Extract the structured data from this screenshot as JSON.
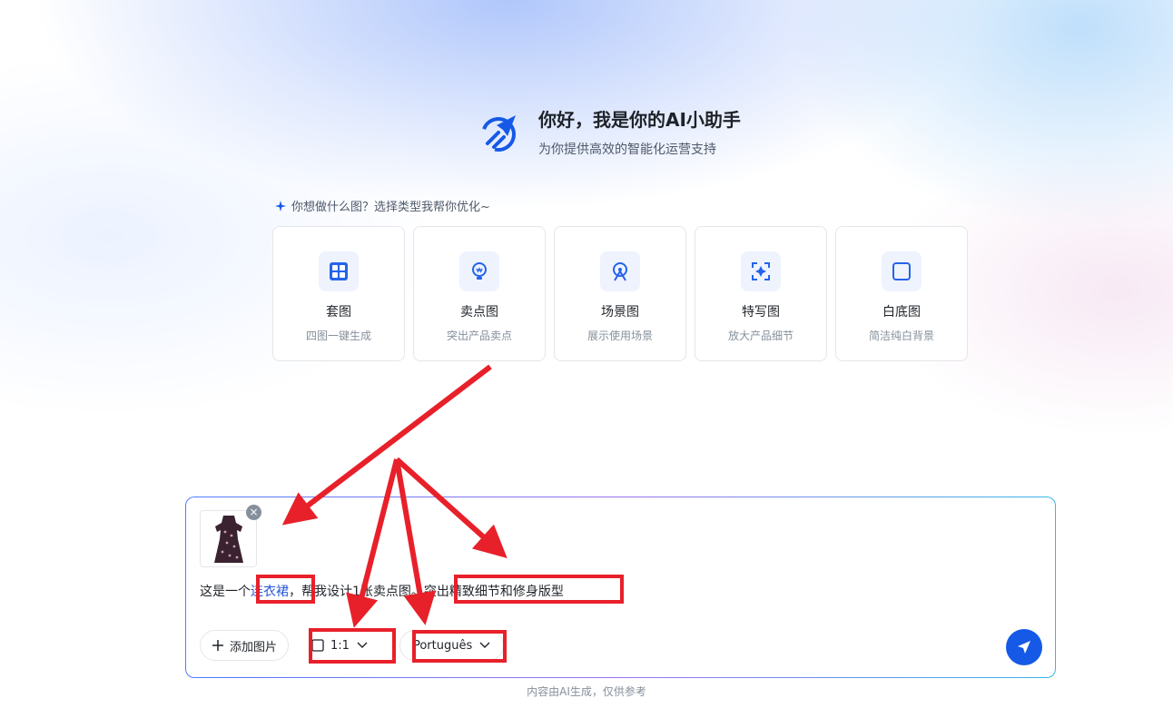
{
  "hero": {
    "title": "你好，我是你的AI小助手",
    "subtitle": "为你提供高效的智能化运营支持"
  },
  "hint": "你想做什么图？选择类型我帮你优化~",
  "cards": [
    {
      "title": "套图",
      "desc": "四图一键生成",
      "icon": "grid-icon"
    },
    {
      "title": "卖点图",
      "desc": "突出产品卖点",
      "icon": "lightbulb-icon"
    },
    {
      "title": "场景图",
      "desc": "展示使用场景",
      "icon": "scene-icon"
    },
    {
      "title": "特写图",
      "desc": "放大产品细节",
      "icon": "focus-icon"
    },
    {
      "title": "白底图",
      "desc": "简洁纯白背景",
      "icon": "square-icon"
    }
  ],
  "composer": {
    "prompt_prefix": "这是一个",
    "prompt_keyword": "连衣裙",
    "prompt_middle": "，帮我设计1张卖点图。",
    "prompt_highlight": "突出精致细节和修身版型",
    "add_image": "添加图片",
    "ratio": "1:1",
    "language": "Português"
  },
  "footnote": "内容由AI生成，仅供参考",
  "colors": {
    "accent": "#1559e6",
    "annotation": "#e8202a"
  }
}
